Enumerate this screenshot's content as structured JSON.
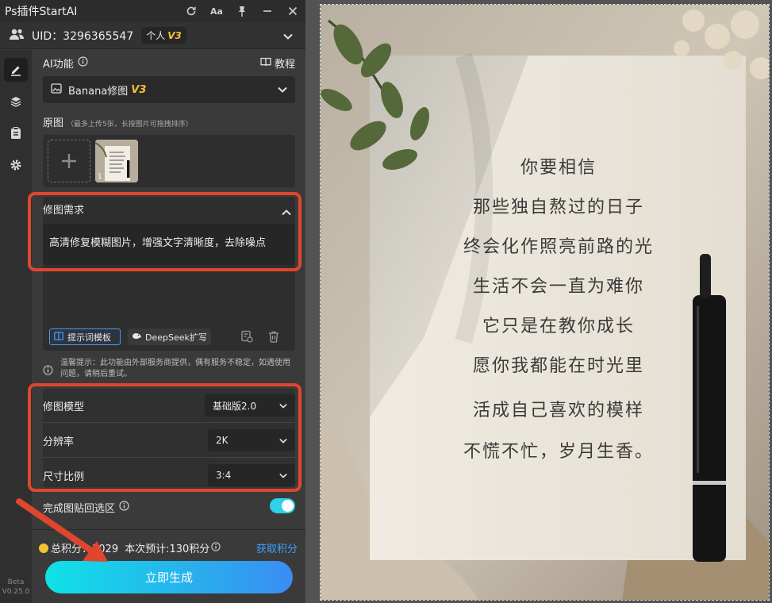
{
  "app": {
    "title": "Ps插件StartAI"
  },
  "user": {
    "uid": "UID：3296365547",
    "plan": "个人",
    "plan_version": "V3"
  },
  "ai": {
    "label": "AI功能",
    "tutorial": "教程",
    "feature": "Banana修图",
    "feature_version": "V3"
  },
  "source": {
    "label": "原图",
    "hint": "（最多上传5张，长按图片可拖拽排序）",
    "thumb_index": "1"
  },
  "request": {
    "label": "修图需求",
    "text": "高清修复模糊图片，增强文字清晰度，去除噪点",
    "template_button": "提示词模板",
    "deepseek_button": "DeepSeek扩写"
  },
  "notice": {
    "text": "温馨提示：此功能由外部服务商提供，偶有服务不稳定，如遇使用问题，请稍后重试。"
  },
  "settings": {
    "model_label": "修图模型",
    "model_value": "基础版2.0",
    "resolution_label": "分辨率",
    "resolution_value": "2K",
    "ratio_label": "尺寸比例",
    "ratio_value": "3:4"
  },
  "paste": {
    "label": "完成图贴回选区",
    "enabled": true
  },
  "points": {
    "total": "总积分：1029",
    "estimate": "本次预计:130积分",
    "get": "获取积分"
  },
  "generate": {
    "label": "立即生成"
  },
  "version": {
    "beta": "Beta",
    "number": "V0.25.0"
  },
  "note_lines": [
    "你要相信",
    "那些独自熬过的日子",
    "终会化作照亮前路的光",
    "生活不会一直为难你",
    "它只是在教你成长",
    "愿你我都能在时光里",
    "活成自己喜欢的模样",
    "不慌不忙，岁月生香。"
  ],
  "colors": {
    "accent": "#2fd0e8",
    "highlight": "#e0452e",
    "version": "#f2c230",
    "link": "#3aa0ff"
  }
}
